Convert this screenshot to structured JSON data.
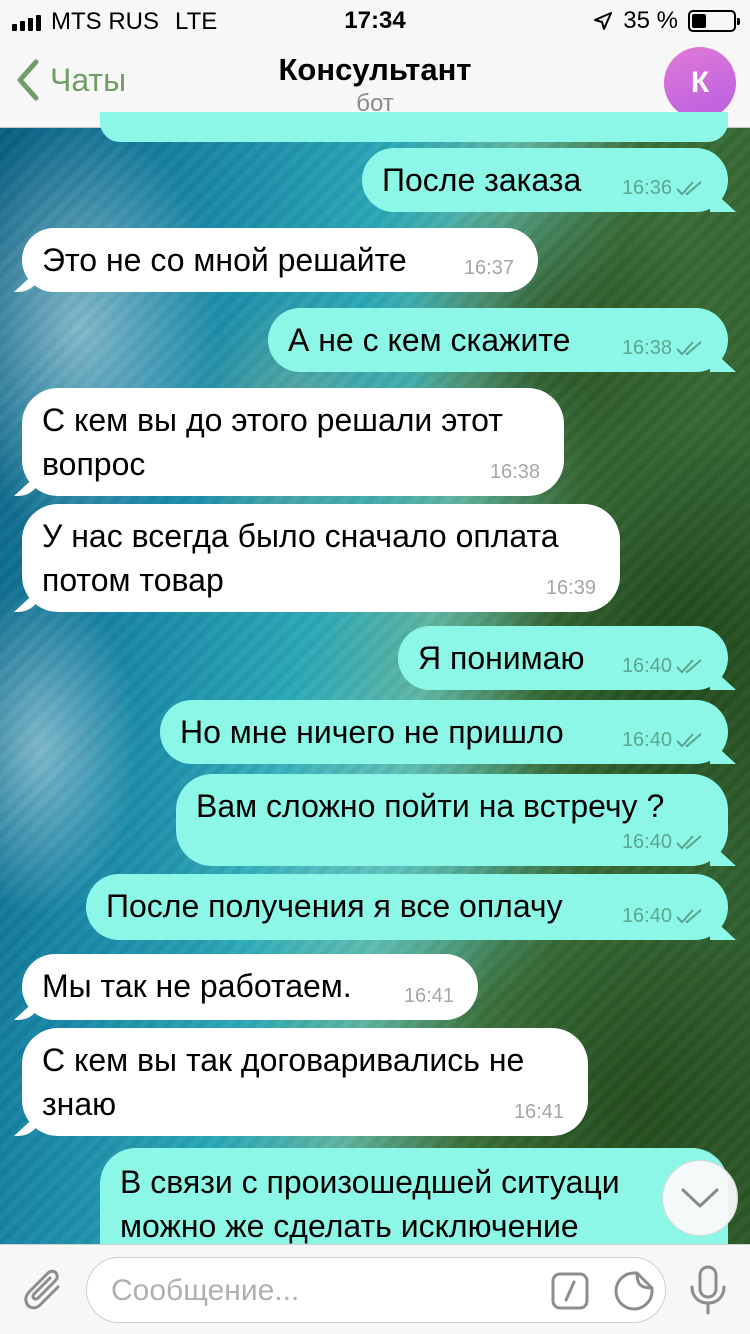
{
  "status_bar": {
    "carrier": "MTS RUS",
    "network": "LTE",
    "time": "17:34",
    "battery": "35 %",
    "battery_level": 0.35
  },
  "header": {
    "back_label": "Чаты",
    "title": "Консультант",
    "subtitle": "бот",
    "avatar_letter": "К",
    "avatar_color": "#c96ae0"
  },
  "messages": [
    {
      "text": "После заказа",
      "time": "16:36",
      "out": true
    },
    {
      "text": "Это не со мной решайте",
      "time": "16:37",
      "out": false
    },
    {
      "text": "А не с кем скажите",
      "time": "16:38",
      "out": true
    },
    {
      "text": "С кем вы до этого решали этот вопрос",
      "time": "16:38",
      "out": false
    },
    {
      "text": "У нас всегда было сначало оплата потом товар",
      "time": "16:39",
      "out": false
    },
    {
      "text": "Я понимаю",
      "time": "16:40",
      "out": true
    },
    {
      "text": "Но мне ничего не пришло",
      "time": "16:40",
      "out": true
    },
    {
      "text": "Вам сложно пойти на встречу ?",
      "time": "16:40",
      "out": true
    },
    {
      "text": "После получения я все оплачу",
      "time": "16:40",
      "out": true
    },
    {
      "text": "Мы так не работаем.",
      "time": "16:41",
      "out": false
    },
    {
      "text": "С кем вы так договаривались не знаю",
      "time": "16:41",
      "out": false
    },
    {
      "text": "В связи с произошедшей ситуаци можно же сделать исключение",
      "time": "",
      "out": true
    }
  ],
  "composer": {
    "placeholder": "Сообщение..."
  },
  "colors": {
    "outgoing_bubble": "#8cf7e6",
    "incoming_bubble": "#ffffff",
    "accent": "#6f9f64"
  }
}
